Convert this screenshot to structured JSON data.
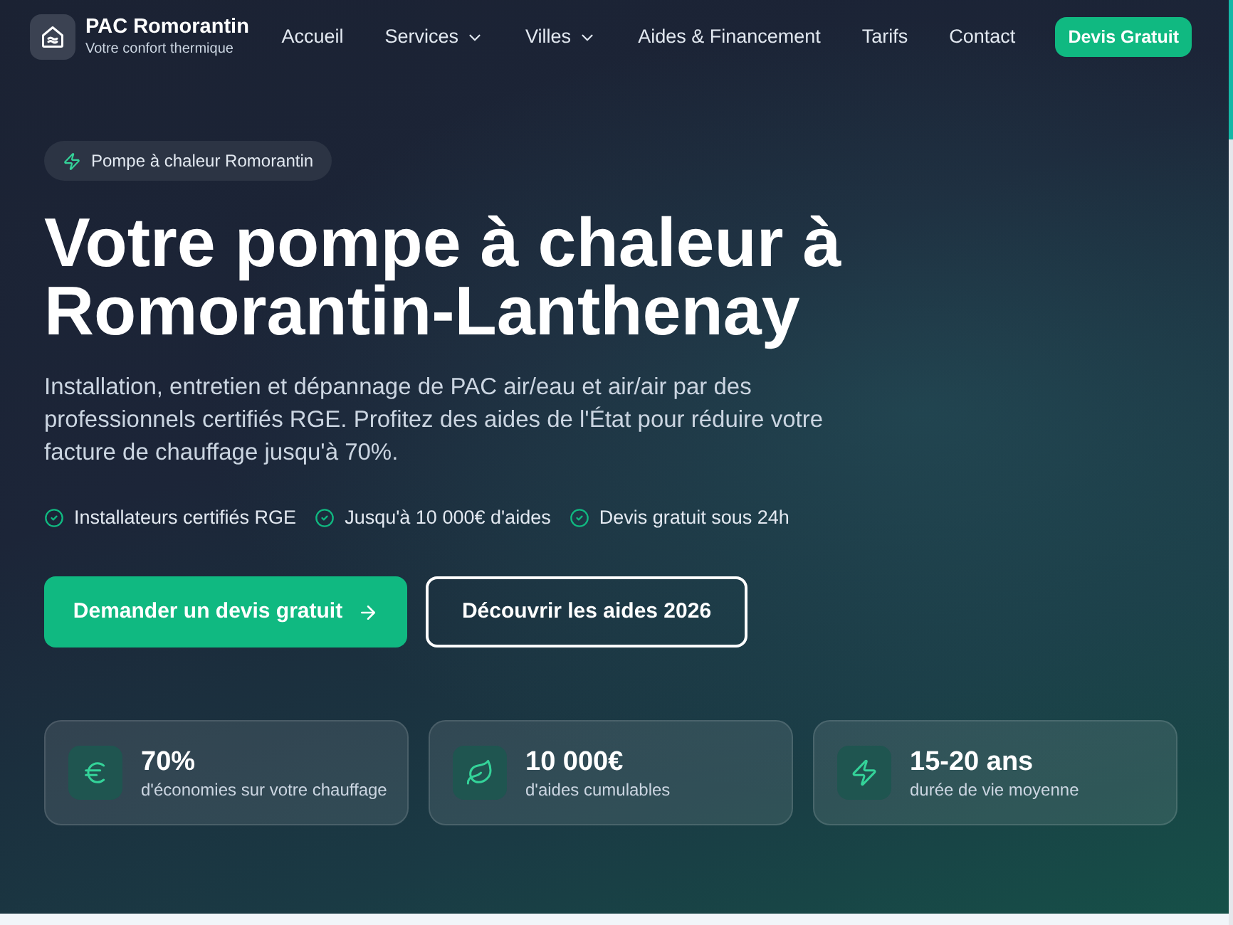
{
  "brand": {
    "name": "PAC Romorantin",
    "tagline": "Votre confort thermique"
  },
  "nav": {
    "links": [
      {
        "label": "Accueil",
        "dropdown": false
      },
      {
        "label": "Services",
        "dropdown": true
      },
      {
        "label": "Villes",
        "dropdown": true
      },
      {
        "label": "Aides & Financement",
        "dropdown": false
      },
      {
        "label": "Tarifs",
        "dropdown": false
      },
      {
        "label": "Contact",
        "dropdown": false
      }
    ],
    "cta": "Devis Gratuit"
  },
  "hero": {
    "badge": "Pompe à chaleur Romorantin",
    "title": "Votre pompe à chaleur à Romorantin-Lanthenay",
    "description": "Installation, entretien et dépannage de PAC air/eau et air/air par des professionnels certifiés RGE. Profitez des aides de l'État pour réduire votre facture de chauffage jusqu'à 70%.",
    "highlights": [
      "Installateurs certifiés RGE",
      "Jusqu'à 10 000€ d'aides",
      "Devis gratuit sous 24h"
    ],
    "buttons": [
      {
        "label": "Demander un devis gratuit",
        "kind": "primary"
      },
      {
        "label": "Découvrir les aides 2026",
        "kind": "outline"
      }
    ]
  },
  "stats": [
    {
      "value": "70%",
      "label": "d'économies sur votre chauffage"
    },
    {
      "value": "10 000€",
      "label": "d'aides cumulables"
    },
    {
      "value": "15-20 ans",
      "label": "durée de vie moyenne"
    }
  ]
}
